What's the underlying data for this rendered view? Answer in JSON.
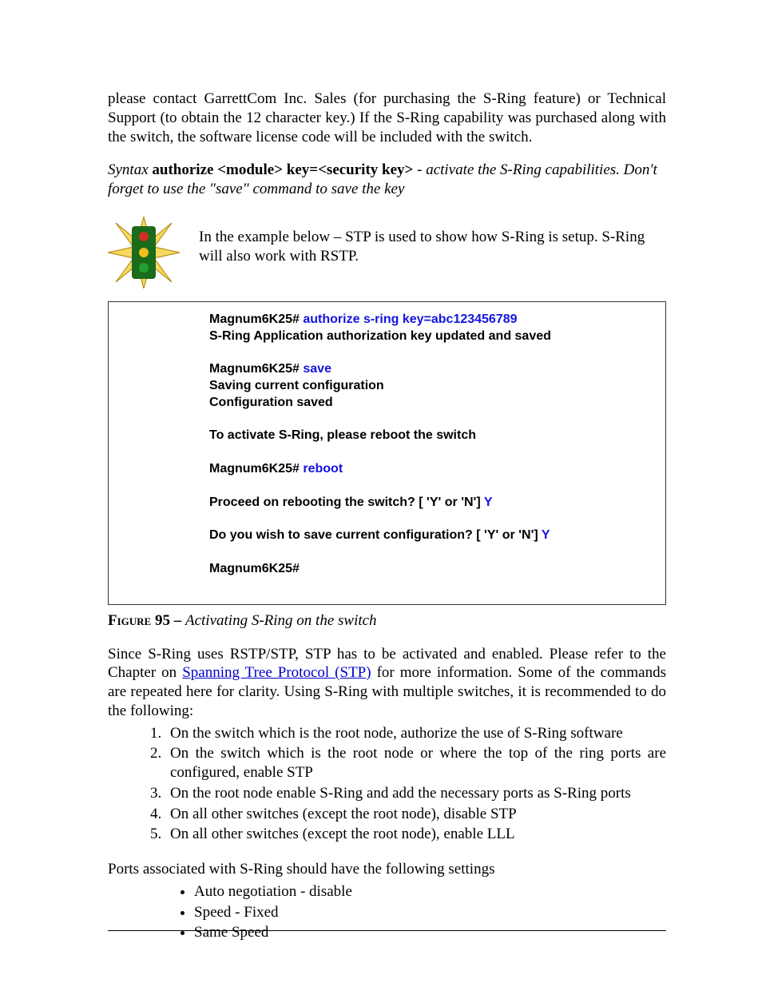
{
  "intro": "please contact GarrettCom Inc. Sales (for purchasing the S-Ring feature) or Technical Support (to obtain the 12 character key.) If the S-Ring capability was purchased along with the switch, the software license code will be included with the switch.",
  "syntax": {
    "label": "Syntax ",
    "command": "authorize <module> key=<security key>",
    "desc": " - activate the S-Ring capabilities. Don't forget to use the \"save\" command to save the key"
  },
  "example_note": "In the example below – STP is used to show how S-Ring is setup. S-Ring will also work with RSTP.",
  "terminal": {
    "l1a": "Magnum6K25# ",
    "l1b": "authorize s-ring key=abc123456789",
    "l2": "S-Ring Application authorization key updated and saved",
    "l3a": "Magnum6K25# ",
    "l3b": "save",
    "l4": "Saving current configuration",
    "l5": "Configuration saved",
    "l6": "To activate S-Ring, please reboot the switch",
    "l7a": "Magnum6K25# ",
    "l7b": "reboot",
    "l8a": "Proceed on rebooting the switch? [ 'Y' or 'N'] ",
    "l8b": "Y",
    "l9a": "Do you wish to save current configuration? [ 'Y' or 'N'] ",
    "l9b": "Y",
    "l10": "Magnum6K25#"
  },
  "figure": {
    "label": "Figure 95 – ",
    "caption": "Activating S-Ring on the switch"
  },
  "after_fig": {
    "p1a": "Since S-Ring uses RSTP/STP, STP has to be activated and enabled. Please refer to the Chapter on ",
    "link": "Spanning Tree Protocol (STP)",
    "p1b": " for more information. Some of the commands are repeated here for clarity. Using S-Ring with multiple switches, it is recommended to do the following:"
  },
  "steps": [
    "On the switch which is the root node, authorize the use of S-Ring software",
    "On the switch which is the root node or where the top of the ring ports are configured, enable STP",
    "On the root node enable S-Ring and add the necessary ports as S-Ring ports",
    " On all other switches (except the root node), disable STP",
    "On all other switches (except the root node), enable LLL"
  ],
  "settings_intro": "Ports associated with S-Ring should have the following settings",
  "bullets": [
    "Auto negotiation - disable",
    "Speed - Fixed",
    "Same Speed"
  ]
}
